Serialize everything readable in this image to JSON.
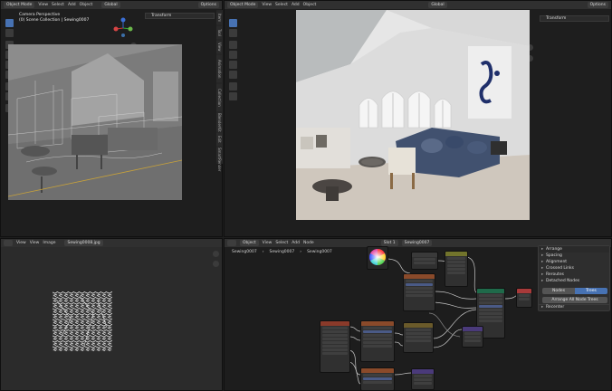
{
  "top_left": {
    "header": {
      "mode": "Object Mode",
      "menus": [
        "View",
        "Select",
        "Add",
        "Object"
      ],
      "orientation": "Global",
      "options": "Options"
    },
    "overlay": {
      "line1": "Camera Perspective",
      "line2": "(0) Scene Collection | Sewing0007"
    },
    "n_panel": {
      "title": "Transform"
    },
    "side_tabs": [
      "Item",
      "Tool",
      "View",
      "Animation",
      "Collection",
      "BlenderKit",
      "Edit",
      "SmartRender"
    ]
  },
  "top_right": {
    "header": {
      "mode": "Object Mode",
      "menus": [
        "View",
        "Select",
        "Add",
        "Object"
      ],
      "orientation": "Global",
      "options": "Options"
    },
    "n_panel": {
      "title": "Transform"
    }
  },
  "bottom_left": {
    "header": {
      "menus": [
        "View",
        "View",
        "Image"
      ],
      "image_name": "Sewing0008.jpg"
    }
  },
  "bottom_right": {
    "header": {
      "editor": "Object",
      "menus": [
        "View",
        "Select",
        "Add",
        "Node"
      ],
      "slot": "Slot 1",
      "material": "Sewing0007"
    },
    "breadcrumb": [
      "Sewing0007",
      "Sewing0007",
      "Sewing0007"
    ],
    "panel": {
      "title": "Arrange",
      "items": [
        "Spacing",
        "Alignment",
        "Crossed Links",
        "Reroutes",
        "Detached Nodes"
      ],
      "toggle_a": "Nodes",
      "toggle_b": "Trees",
      "action_button": "Arrange All Node Trees",
      "section2": "Recenter"
    }
  },
  "colors": {
    "accent": "#4772b3",
    "header_bg": "#303030",
    "editor_bg": "#1d1d1d"
  }
}
